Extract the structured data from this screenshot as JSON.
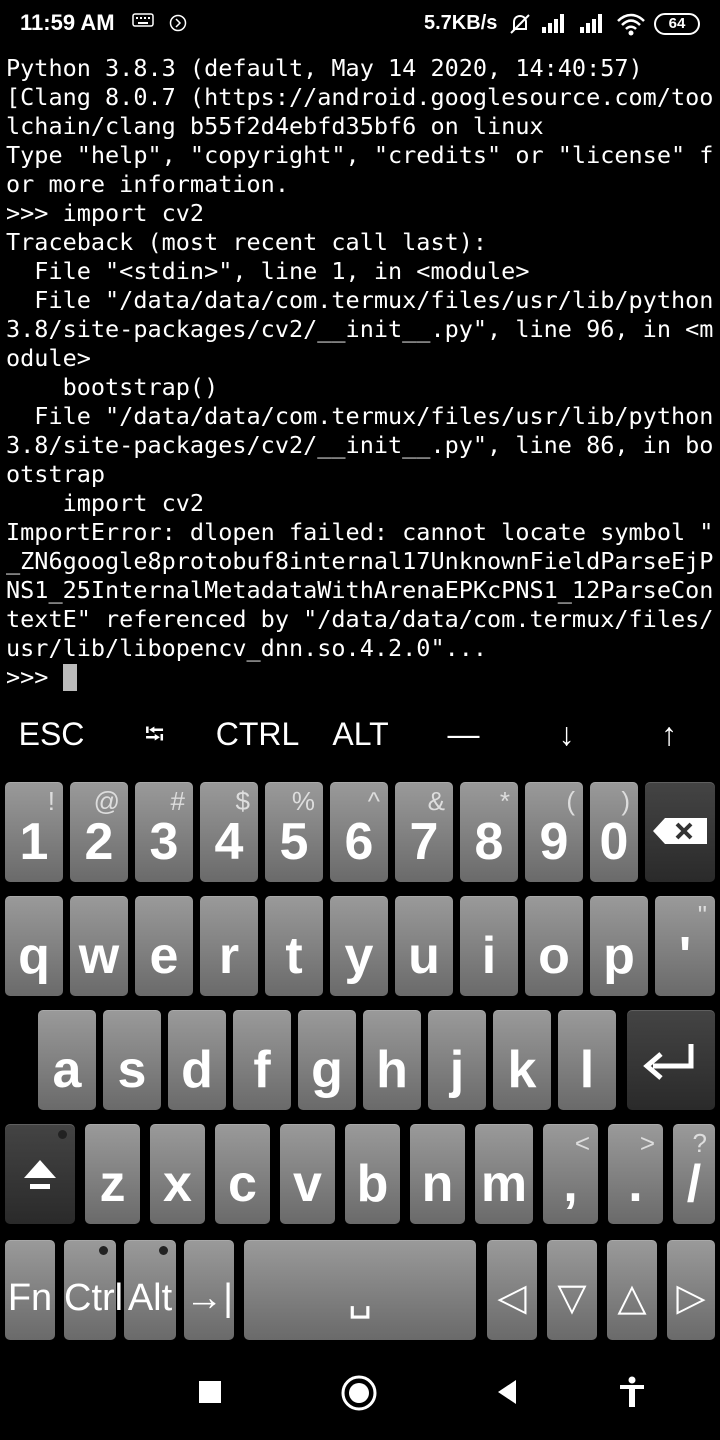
{
  "status_bar": {
    "time": "11:59 AM",
    "network_speed": "5.7KB/s",
    "battery": "64",
    "icons": [
      "keyboard-icon",
      "circle-icon",
      "bell-muted-icon",
      "signal-icon",
      "signal-icon",
      "wifi-icon",
      "battery-icon"
    ]
  },
  "terminal": {
    "lines": [
      "Python 3.8.3 (default, May 14 2020, 14:40:57)",
      "[Clang 8.0.7 (https://android.googlesource.com/too",
      "lchain/clang b55f2d4ebfd35bf6 on linux",
      "Type \"help\", \"copyright\", \"credits\" or \"license\" f",
      "or more information.",
      ">>> import cv2",
      "Traceback (most recent call last):",
      "  File \"<stdin>\", line 1, in <module>",
      "  File \"/data/data/com.termux/files/usr/lib/python",
      "3.8/site-packages/cv2/__init__.py\", line 96, in <m",
      "odule>",
      "    bootstrap()",
      "  File \"/data/data/com.termux/files/usr/lib/python",
      "3.8/site-packages/cv2/__init__.py\", line 86, in bo",
      "otstrap",
      "    import cv2",
      "ImportError: dlopen failed: cannot locate symbol \"",
      "_ZN6google8protobuf8internal17UnknownFieldParseEjP",
      "NS1_25InternalMetadataWithArenaEPKcPNS1_12ParseCon",
      "textE\" referenced by \"/data/data/com.termux/files/",
      "usr/lib/libopencv_dnn.so.4.2.0\"..."
    ],
    "prompt": ">>> "
  },
  "extra_keys": {
    "esc": "ESC",
    "tab": "⭾",
    "ctrl": "CTRL",
    "alt": "ALT",
    "dash": "—",
    "down": "↓",
    "up": "↑"
  },
  "keyboard": {
    "row1": [
      {
        "main": "1",
        "sub": "!"
      },
      {
        "main": "2",
        "sub": "@"
      },
      {
        "main": "3",
        "sub": "#"
      },
      {
        "main": "4",
        "sub": "$"
      },
      {
        "main": "5",
        "sub": "%"
      },
      {
        "main": "6",
        "sub": "^"
      },
      {
        "main": "7",
        "sub": "&"
      },
      {
        "main": "8",
        "sub": "*"
      },
      {
        "main": "9",
        "sub": "("
      },
      {
        "main": "0",
        "sub": ")"
      }
    ],
    "row2": [
      "q",
      "w",
      "e",
      "r",
      "t",
      "y",
      "u",
      "i",
      "o",
      "p"
    ],
    "row2_quote": {
      "main": "'",
      "sub": "\""
    },
    "row3": [
      "a",
      "s",
      "d",
      "f",
      "g",
      "h",
      "j",
      "k",
      "l"
    ],
    "row4": [
      "z",
      "x",
      "c",
      "v",
      "b",
      "n",
      "m"
    ],
    "row4_punct": [
      {
        "main": ",",
        "sub": "<"
      },
      {
        "main": ".",
        "sub": ">"
      },
      {
        "main": "/",
        "sub": "?"
      }
    ],
    "row5": {
      "fn": "Fn",
      "ctrl": "Ctrl",
      "alt": "Alt",
      "tab": "→|",
      "space": "␣",
      "left": "◁",
      "down": "▽",
      "up": "△",
      "right": "▷"
    }
  }
}
